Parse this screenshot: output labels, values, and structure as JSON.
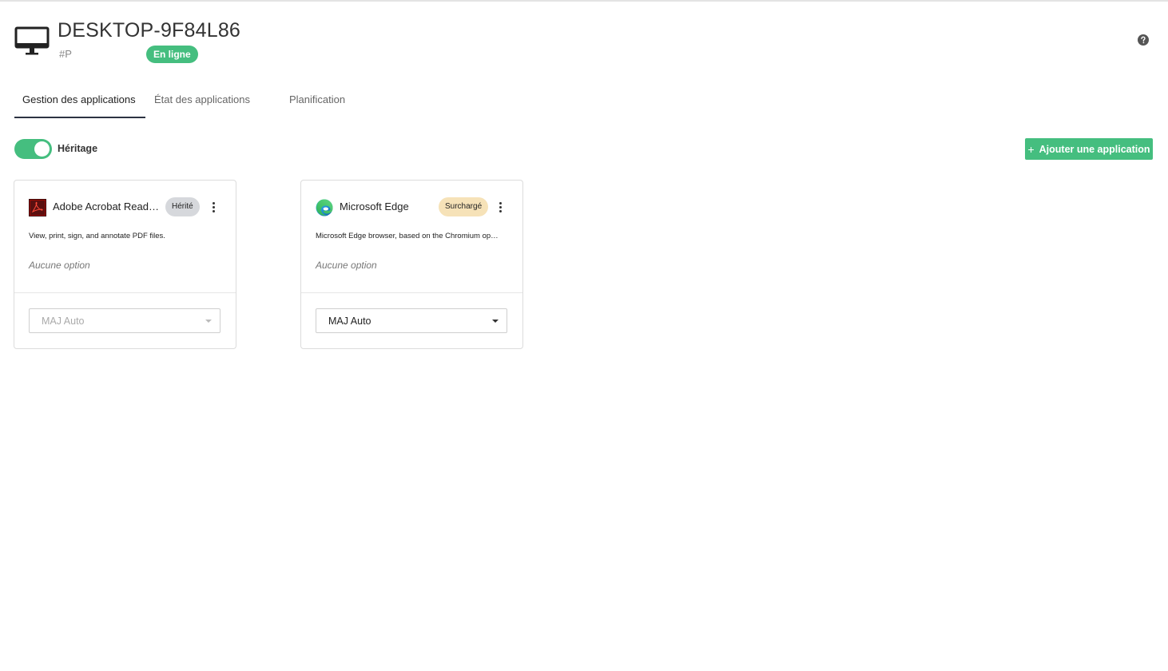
{
  "device": {
    "name": "DESKTOP-9F84L86",
    "id": "#P",
    "status": "En ligne",
    "icon": "desktop-monitor-icon"
  },
  "help": {
    "icon": "help-circle-icon"
  },
  "tabs": [
    {
      "label": "Gestion des applications",
      "active": true
    },
    {
      "label": "État des applications",
      "active": false
    },
    {
      "label": "Planification",
      "active": false
    }
  ],
  "inheritance": {
    "label": "Héritage",
    "enabled": true
  },
  "actions": {
    "add_label": "Ajouter une application",
    "add_icon": "plus-icon"
  },
  "apps": [
    {
      "name": "Adobe Acrobat Reader...",
      "badge": "Hérité",
      "description": "View, print, sign, and annotate PDF files.",
      "options": "Aucune option",
      "update_mode": "MAJ Auto",
      "update_disabled": true,
      "icon": "adobe-acrobat-icon"
    },
    {
      "name": "Microsoft Edge",
      "badge": "Surchargé",
      "description": "Microsoft Edge browser, based on the Chromium op…",
      "options": "Aucune option",
      "update_mode": "MAJ Auto",
      "update_disabled": false,
      "icon": "microsoft-edge-icon"
    }
  ],
  "colors": {
    "accent": "#45be7f",
    "tab_indicator": "#2c3342",
    "badge_inherited": "#d6d8dc",
    "badge_overridden": "#f6e2b8"
  }
}
